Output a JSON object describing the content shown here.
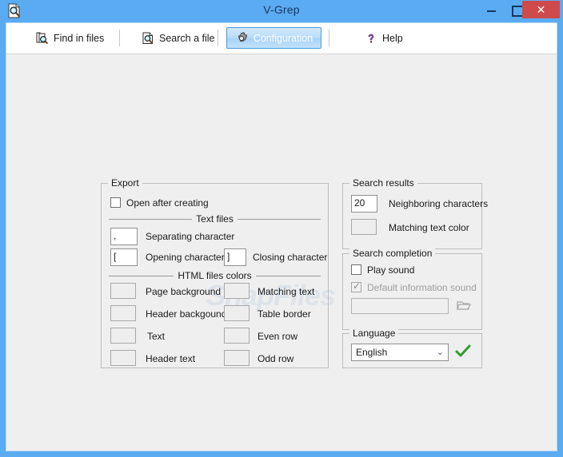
{
  "window": {
    "title": "V-Grep",
    "app_icon": "document-search-icon",
    "minimize_label": "Minimize",
    "maximize_label": "Maximize",
    "close_label": "Close",
    "close_glyph": "✕",
    "frame_color": "#5aabf2",
    "close_color": "#cf4b4b"
  },
  "toolbar": {
    "items": [
      {
        "label": "Find in files",
        "icon": "find-in-files-icon",
        "active": false
      },
      {
        "label": "Search a file",
        "icon": "search-file-icon",
        "active": false
      },
      {
        "label": "Configuration",
        "icon": "gear-icon",
        "active": true
      },
      {
        "label": "Help",
        "icon": "question-mark-icon",
        "active": false
      }
    ],
    "active_accent": "#4a9bdc"
  },
  "export": {
    "title": "Export",
    "open_after_creating": {
      "label": "Open after creating",
      "checked": false
    },
    "text_files_section": "Text files",
    "separating_character": {
      "label": "Separating character",
      "value": ","
    },
    "opening_character": {
      "label": "Opening character",
      "value": "["
    },
    "closing_character": {
      "label": "Closing character",
      "value": "]"
    },
    "html_colors_section": "HTML files colors",
    "colors_left": [
      {
        "label": "Page background",
        "value": ""
      },
      {
        "label": "Header backgound",
        "value": ""
      },
      {
        "label": "Text",
        "value": ""
      },
      {
        "label": "Header text",
        "value": ""
      }
    ],
    "colors_right": [
      {
        "label": "Matching text",
        "value": ""
      },
      {
        "label": "Table border",
        "value": ""
      },
      {
        "label": "Even row",
        "value": ""
      },
      {
        "label": "Odd row",
        "value": ""
      }
    ]
  },
  "search_results": {
    "title": "Search results",
    "neighboring_characters": {
      "label": "Neighboring characters",
      "value": "20"
    },
    "matching_text_color": {
      "label": "Matching text color",
      "value": ""
    }
  },
  "search_completion": {
    "title": "Search completion",
    "play_sound": {
      "label": "Play sound",
      "checked": false,
      "disabled": false
    },
    "default_information_sound": {
      "label": "Default information sound",
      "checked": true,
      "disabled": true
    },
    "sound_file": {
      "value": "",
      "disabled": true
    },
    "browse_icon": "open-folder-icon"
  },
  "language": {
    "title": "Language",
    "selected": "English",
    "arrow": "⌄",
    "apply_icon": "green-check-icon",
    "apply_color": "#2f9e2f"
  },
  "watermark": {
    "text": "SnapFiles"
  }
}
